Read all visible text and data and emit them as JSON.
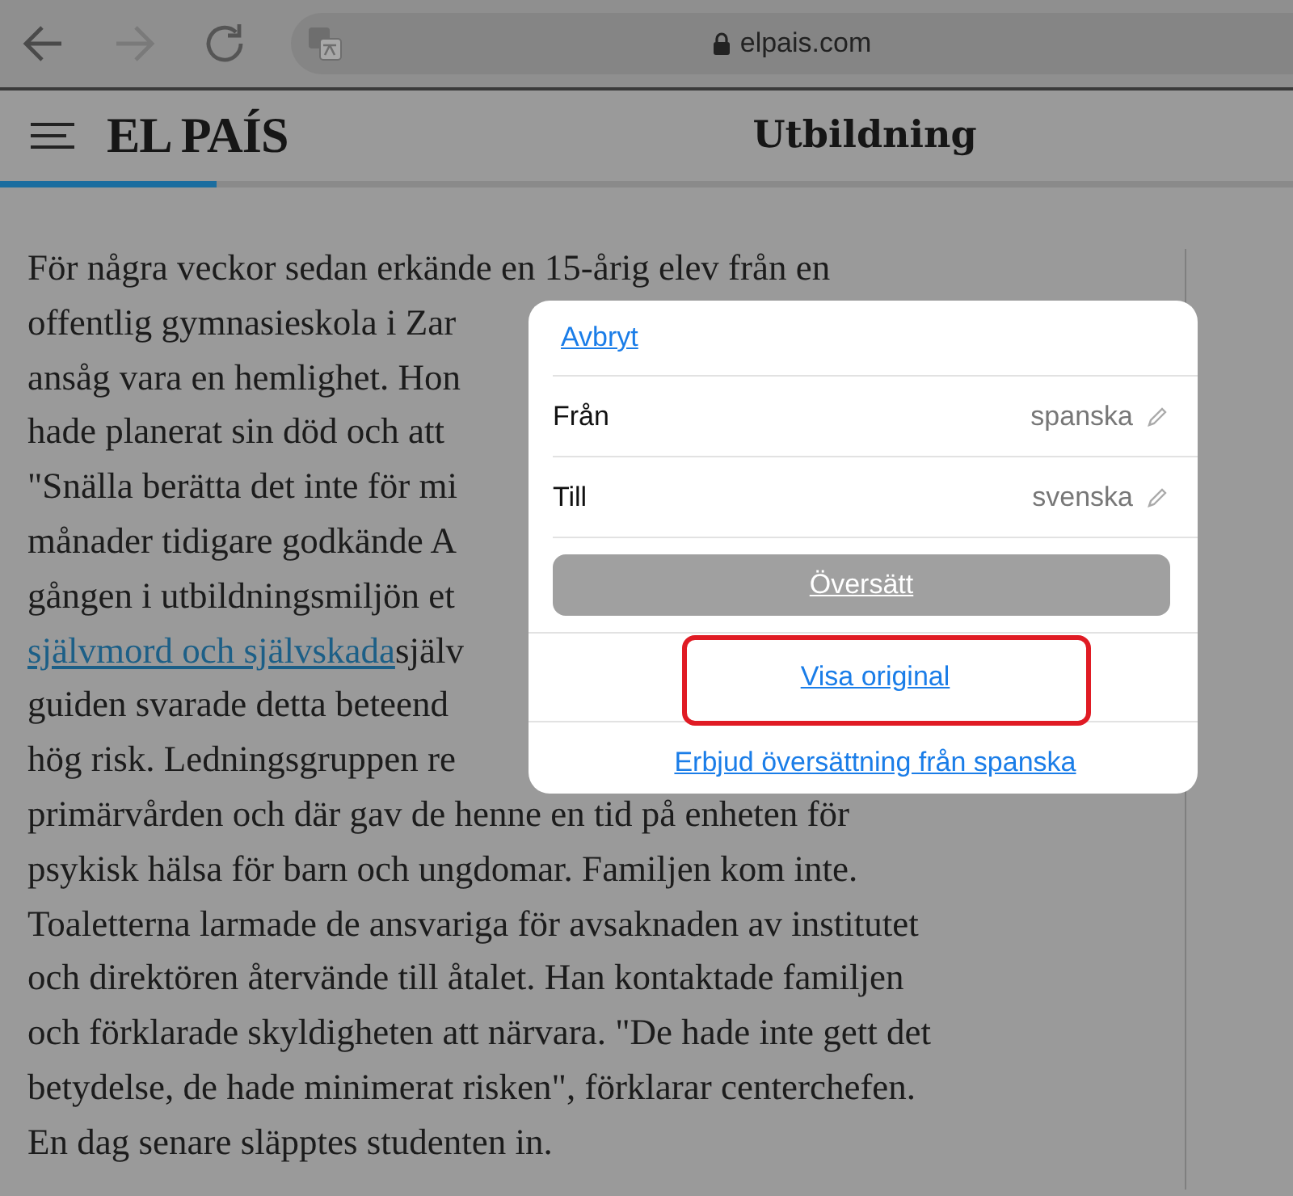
{
  "browser": {
    "back": {
      "disabled": false
    },
    "forward": {
      "disabled": true
    },
    "url": "elpais.com"
  },
  "header": {
    "logo": "EL PAÍS",
    "section": "Utbildning",
    "progress": {
      "level": 0.167
    }
  },
  "article": {
    "lines": [
      {
        "text": "För några veckor sedan erkände en 15-årig elev från en"
      },
      {
        "text": "offentlig gymnasieskola i Zar"
      },
      {
        "text": "ansåg vara en hemlighet. Hon"
      },
      {
        "text": "hade planerat sin död och att"
      },
      {
        "text": "\"Snälla berätta det inte för mi"
      },
      {
        "text": "månader tidigare godkände A"
      },
      {
        "text": "gången i utbildningsmiljön et"
      },
      {
        "link": "självmord och självskada",
        "text": "själv"
      },
      {
        "text": "guiden svarade detta beteend"
      },
      {
        "text": "hög risk. Ledningsgruppen re"
      },
      {
        "text": "primärvården och där gav de henne en tid på enheten för"
      },
      {
        "text": "psykisk hälsa för barn och ungdomar. Familjen kom inte."
      },
      {
        "text": "Toaletterna larmade de ansvariga för avsaknaden av institutet"
      },
      {
        "text": "och direktören återvände till åtalet. Han kontaktade familjen"
      },
      {
        "text": "och förklarade skyldigheten att närvara. \"De hade inte gett det"
      },
      {
        "text": "betydelse, de hade minimerat risken\", förklarar centerchefen."
      },
      {
        "text": "En dag senare släpptes studenten in."
      }
    ]
  },
  "translate_popup": {
    "cancel": "Avbryt",
    "rows": [
      {
        "label": "Från",
        "value": "spanska"
      },
      {
        "label": "Till",
        "value": "svenska"
      }
    ],
    "translate_button": {
      "label": "Översätt",
      "disabled": true
    },
    "show_original": {
      "label": "Visa original",
      "highlighted": true
    },
    "offer_link": "Erbjud översättning från spanska"
  }
}
